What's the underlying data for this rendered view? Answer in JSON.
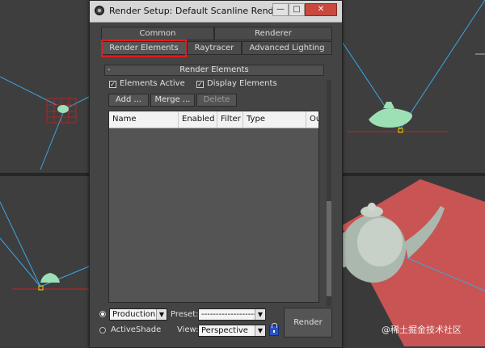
{
  "dialog": {
    "title": "Render Setup: Default Scanline Renderer",
    "window_buttons": {
      "minimize": "—",
      "maximize": "□",
      "close": "✕"
    }
  },
  "tabs": {
    "row1": [
      "Common",
      "Renderer"
    ],
    "row2": [
      "Render Elements",
      "Raytracer",
      "Advanced Lighting"
    ],
    "active": "Render Elements"
  },
  "rollout": {
    "title": "Render Elements",
    "collapse_symbol": "-",
    "elements_active_label": "Elements Active",
    "display_elements_label": "Display Elements",
    "add_button": "Add ...",
    "merge_button": "Merge ...",
    "delete_button": "Delete"
  },
  "list": {
    "columns": [
      "Name",
      "Enabled",
      "Filter",
      "Type",
      "Ou"
    ]
  },
  "bottom": {
    "mode_production": "Production",
    "mode_activeshade": "ActiveShade",
    "preset_label": "Preset:",
    "preset_value": "--------------------",
    "view_label": "View:",
    "view_value": "Perspective",
    "render_button": "Render"
  },
  "watermark": "@稀土掘金技术社区",
  "colors": {
    "viewport_bg": "#3e3e3e",
    "teapot_wire": "#9ee0b5",
    "floor_red": "#c95454",
    "light_line": "#3aa7e6",
    "highlight_red": "#e01d1d"
  },
  "icons": {
    "app": "3dsmax-app-icon",
    "lock": "lock-icon"
  }
}
